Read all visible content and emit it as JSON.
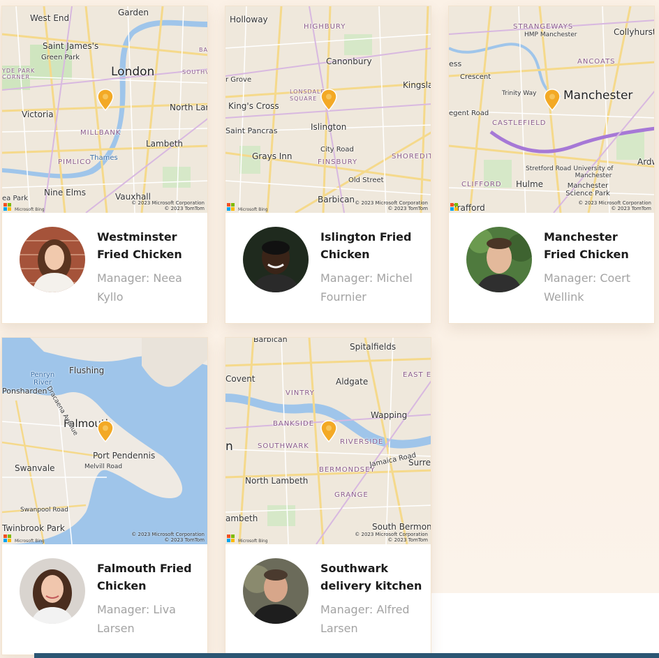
{
  "stores": [
    {
      "name": "Westminster Fried Chicken",
      "manager": "Manager: Neea Kyllo",
      "map_labels": [
        "West End",
        "Garden",
        "Saint James's",
        "Green Park",
        "London",
        "Victoria",
        "North Lam",
        "Lambeth",
        "MILLBANK",
        "PIMLICO",
        "Thames",
        "Nine Elms",
        "Vauxhall",
        "YDE PARK CORNER",
        "ea Park",
        "SOUTHV",
        "BAI"
      ],
      "copyright": [
        "© 2023 Microsoft Corporation",
        "© 2023 TomTom"
      ]
    },
    {
      "name": "Islington Fried Chicken",
      "manager": "Manager: Michel Fournier",
      "map_labels": [
        "Holloway",
        "HIGHBURY",
        "Canonbury",
        "Kingslar",
        "LONSDALE SQUARE",
        "King's Cross",
        "Islington",
        "Saint Pancras",
        "City Road",
        "Grays Inn",
        "FINSBURY",
        "SHOREDITC",
        "Old Street",
        "Barbican",
        "r Grove"
      ],
      "copyright": [
        "© 2023 Microsoft Corporation",
        "© 2023 TomTom"
      ]
    },
    {
      "name": "Manchester Fried Chicken",
      "manager": "Manager: Coert Wellink",
      "map_labels": [
        "STRANGEWAYS",
        "HMP Manchester",
        "Collyhurst",
        "ANCOATS",
        "Manchester",
        "Crescent",
        "egent Road",
        "CASTLEFIELD",
        "Ardw",
        "Hulme",
        "CLIFFORD",
        "Trafford",
        "University of Manchester",
        "Manchester Science Park",
        "Stretford Road",
        "Trinity Way",
        "ess"
      ],
      "copyright": [
        "© 2023 Microsoft Corporation",
        "© 2023 TomTom"
      ]
    },
    {
      "name": "Falmouth Fried Chicken",
      "manager": "Manager: Liva Larsen",
      "map_labels": [
        "Penryn River",
        "Flushing",
        "Ponsharden",
        "Falmouth",
        "Port Pendennis",
        "Swanvale",
        "Melvill Road",
        "Twinbrook Park",
        "Dracaena Avenue",
        "Swanpool Road"
      ],
      "copyright": [
        "© 2023 Microsoft Corporation",
        "© 2023 TomTom"
      ]
    },
    {
      "name": "Southwark delivery kitchen",
      "manager": "Manager: Alfred Larsen",
      "map_labels": [
        "Spitalfields",
        "Covent",
        "Aldgate",
        "VINTRY",
        "EAST EN",
        "Wapping",
        "BANKSIDE",
        "SOUTHWARK",
        "RIVERSIDE",
        "BERMONDSEY",
        "North Lambeth",
        "Jamaica Road",
        "Surrey",
        "GRANGE",
        "ambeth",
        "South Bermond",
        "Barbican",
        "n"
      ],
      "copyright": [
        "© 2023 Microsoft Corporation",
        "© 2023 TomTom"
      ]
    }
  ],
  "brand": {
    "ms_logo_text": "Microsoft Bing"
  },
  "colors": {
    "page_bg": "#fbf1e6",
    "card_bg": "#ffffff",
    "title": "#1c1c1c",
    "manager": "#a3a3a3",
    "pin": "#f3a925",
    "footer_bar": "#2b5673",
    "water": "#9fc5ea"
  },
  "icons": {
    "pin": "map-pin-icon",
    "logo": "microsoft-logo-icon"
  }
}
